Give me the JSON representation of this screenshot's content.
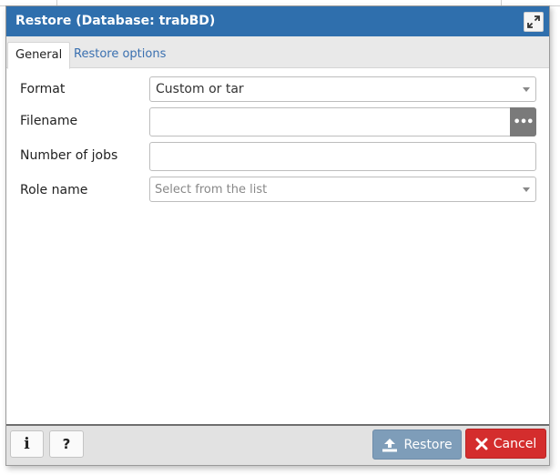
{
  "dialog": {
    "title": "Restore (Database: trabBD)",
    "tabs": [
      {
        "label": "General",
        "active": true
      },
      {
        "label": "Restore options",
        "active": false
      }
    ]
  },
  "form": {
    "format": {
      "label": "Format",
      "value": "Custom or tar"
    },
    "filename": {
      "label": "Filename",
      "value": "",
      "browse_icon": "ellipsis-icon"
    },
    "jobs": {
      "label": "Number of jobs",
      "value": ""
    },
    "role": {
      "label": "Role name",
      "placeholder": "Select from the list"
    }
  },
  "footer": {
    "info_icon": "info-icon",
    "help_label": "?",
    "restore_label": "Restore",
    "cancel_label": "Cancel"
  },
  "colors": {
    "titlebar": "#2f6fad",
    "restore_button": "#7e9db9",
    "cancel_button": "#d42d2d",
    "tab_link": "#3a70b0"
  }
}
